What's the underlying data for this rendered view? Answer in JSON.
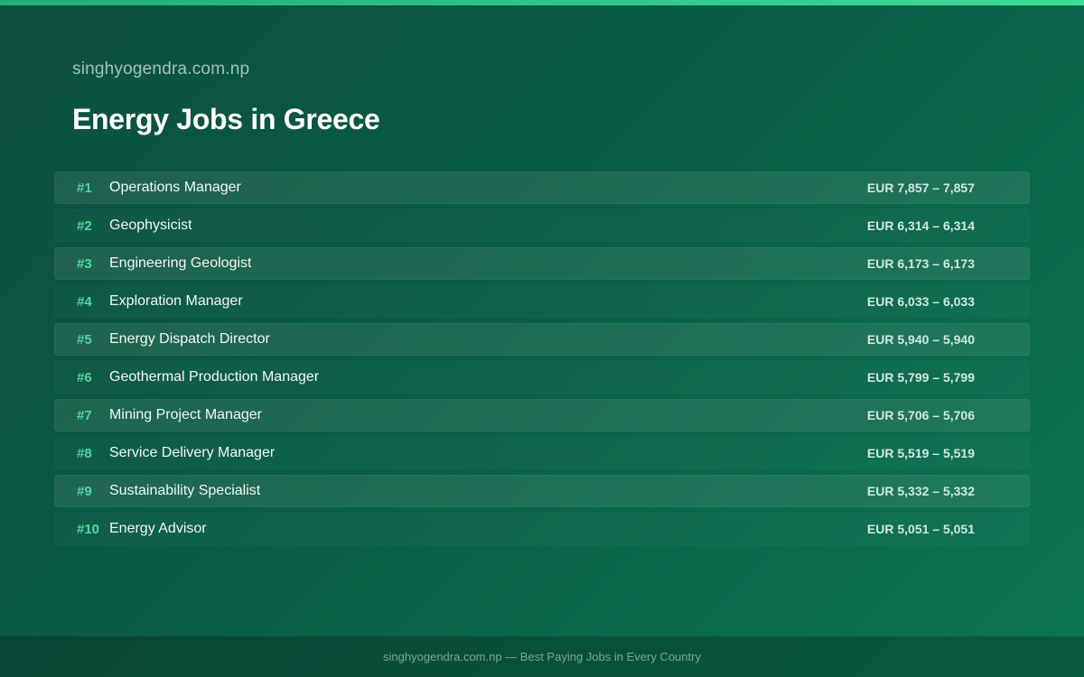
{
  "brand": "singhyogendra.com.np",
  "title": "Energy Jobs in Greece",
  "jobs": [
    {
      "rank": "#1",
      "title": "Operations Manager",
      "salary": "EUR 7,857 – 7,857"
    },
    {
      "rank": "#2",
      "title": "Geophysicist",
      "salary": "EUR 6,314 – 6,314"
    },
    {
      "rank": "#3",
      "title": "Engineering Geologist",
      "salary": "EUR 6,173 – 6,173"
    },
    {
      "rank": "#4",
      "title": "Exploration Manager",
      "salary": "EUR 6,033 – 6,033"
    },
    {
      "rank": "#5",
      "title": "Energy Dispatch Director",
      "salary": "EUR 5,940 – 5,940"
    },
    {
      "rank": "#6",
      "title": "Geothermal Production Manager",
      "salary": "EUR 5,799 – 5,799"
    },
    {
      "rank": "#7",
      "title": "Mining Project Manager",
      "salary": "EUR 5,706 – 5,706"
    },
    {
      "rank": "#8",
      "title": "Service Delivery Manager",
      "salary": "EUR 5,519 – 5,519"
    },
    {
      "rank": "#9",
      "title": "Sustainability Specialist",
      "salary": "EUR 5,332 – 5,332"
    },
    {
      "rank": "#10",
      "title": "Energy Advisor",
      "salary": "EUR 5,051 – 5,051"
    }
  ],
  "footer": "singhyogendra.com.np — Best Paying Jobs in Every Country"
}
